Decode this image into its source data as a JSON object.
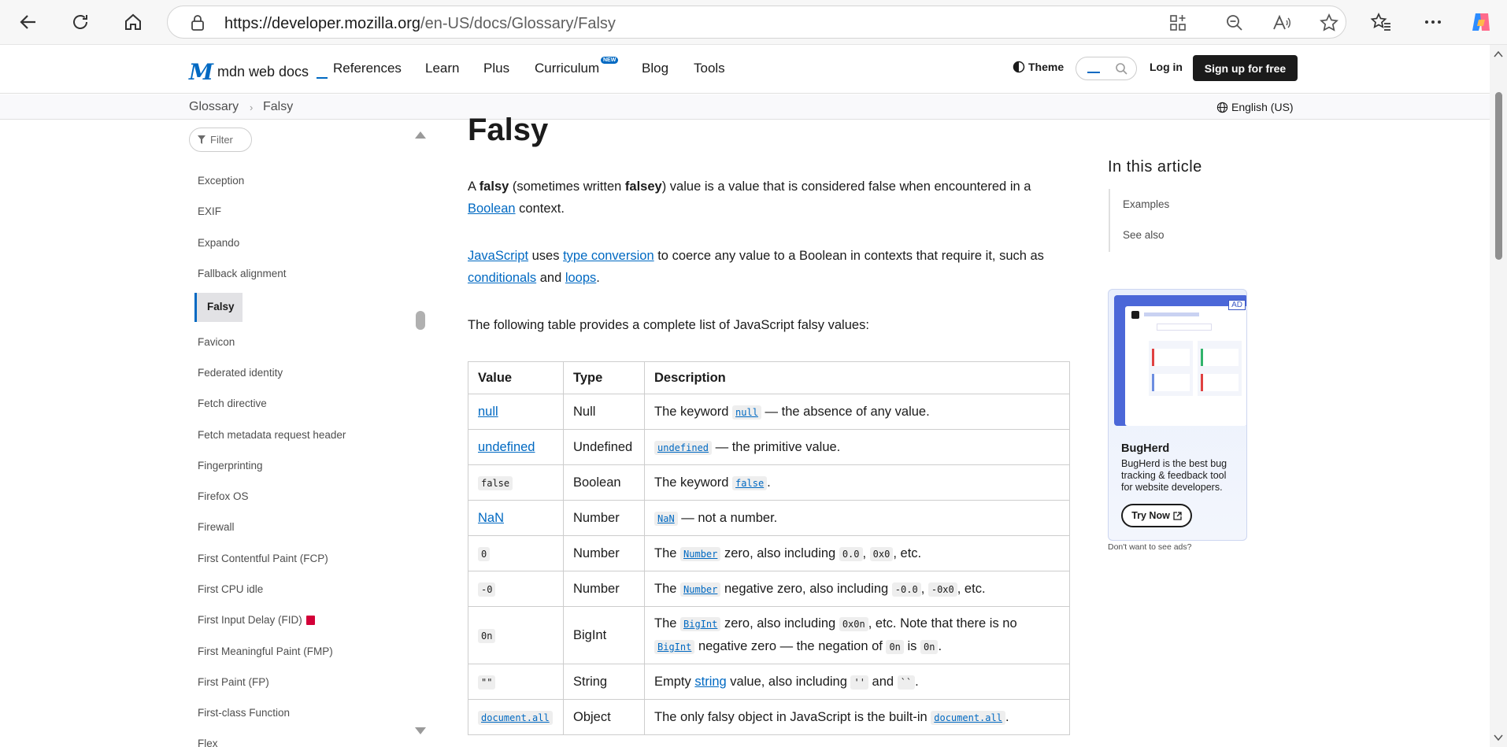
{
  "browser": {
    "url_host": "https://developer.mozilla.org",
    "url_path": "/en-US/docs/Glossary/Falsy"
  },
  "header": {
    "logo": "mdn web docs",
    "nav": [
      "References",
      "Learn",
      "Plus",
      "Curriculum",
      "Blog",
      "Tools"
    ],
    "new_badge": "NEW",
    "theme": "Theme",
    "login": "Log in",
    "signup": "Sign up for free"
  },
  "breadcrumb": {
    "items": [
      "Glossary",
      "Falsy"
    ],
    "language": "English (US)"
  },
  "sidebar": {
    "filter_placeholder": "Filter",
    "items": [
      "Exception",
      "EXIF",
      "Expando",
      "Fallback alignment",
      "Falsy",
      "Favicon",
      "Federated identity",
      "Fetch directive",
      "Fetch metadata request header",
      "Fingerprinting",
      "Firefox OS",
      "Firewall",
      "First Contentful Paint (FCP)",
      "First CPU idle",
      "First Input Delay (FID)",
      "First Meaningful Paint (FMP)",
      "First Paint (FP)",
      "First-class Function",
      "Flex"
    ],
    "active": "Falsy"
  },
  "article": {
    "title": "Falsy",
    "p1": {
      "a": "A ",
      "b": "falsy",
      "c": " (sometimes written ",
      "d": "falsey",
      "e": ") value is a value that is considered false when encountered in a ",
      "link": "Boolean",
      "f": " context."
    },
    "p2": {
      "l1": "JavaScript",
      "t1": " uses ",
      "l2": "type conversion",
      "t2": " to coerce any value to a Boolean in contexts that require it, such as ",
      "l3": "conditionals",
      "t3": " and ",
      "l4": "loops",
      "t4": "."
    },
    "p3": "The following table provides a complete list of JavaScript falsy values:",
    "table": {
      "headers": [
        "Value",
        "Type",
        "Description"
      ],
      "rows": [
        {
          "value": "null",
          "type": "Null",
          "d": [
            "The keyword ",
            "null",
            " — the absence of any value."
          ]
        },
        {
          "value": "undefined",
          "type": "Undefined",
          "d": [
            "undefined",
            " — the primitive value."
          ]
        },
        {
          "value": "false",
          "type": "Boolean",
          "d": [
            "The keyword ",
            "false",
            "."
          ]
        },
        {
          "value": "NaN",
          "type": "Number",
          "d": [
            "NaN",
            " — not a number."
          ]
        },
        {
          "value": "0",
          "type": "Number",
          "d": [
            "The ",
            "Number",
            " zero, also including ",
            "0.0",
            ", ",
            "0x0",
            ", etc."
          ]
        },
        {
          "value": "-0",
          "type": "Number",
          "d": [
            "The ",
            "Number",
            " negative zero, also including ",
            "-0.0",
            ", ",
            "-0x0",
            ", etc."
          ]
        },
        {
          "value": "0n",
          "type": "BigInt",
          "d": [
            "The ",
            "BigInt",
            " zero, also including ",
            "0x0n",
            ", etc. Note that there is no ",
            "BigInt",
            " negative zero — the negation of ",
            "0n",
            " is ",
            "0n",
            "."
          ]
        },
        {
          "value": "\"\"",
          "type": "String",
          "d": [
            "Empty ",
            "string",
            " value, also including ",
            "''",
            " and ",
            "``",
            "."
          ]
        },
        {
          "value": "document.all",
          "type": "Object",
          "d": [
            "The only falsy object in JavaScript is the built-in ",
            "document.all",
            "."
          ]
        }
      ]
    }
  },
  "toc": {
    "title": "In this article",
    "items": [
      "Examples",
      "See also"
    ]
  },
  "ad": {
    "tag": "AD",
    "name": "BugHerd",
    "description": "BugHerd is the best bug tracking & feedback tool for website developers.",
    "button": "Try Now",
    "note": "Don't want to see ads?"
  },
  "colors": {
    "link": "#0069c2",
    "signup_bg": "#1b1b1b",
    "delete_icon": "#d30038"
  },
  "icons": [
    "back-arrow-icon",
    "refresh-icon",
    "home-icon",
    "lock-icon",
    "apps-icon",
    "zoom-out-icon",
    "read-aloud-icon",
    "star-icon",
    "favorites-icon",
    "more-icon",
    "copilot-icon",
    "theme-icon",
    "search-icon",
    "globe-icon",
    "filter-icon",
    "trash-icon",
    "external-link-icon"
  ]
}
